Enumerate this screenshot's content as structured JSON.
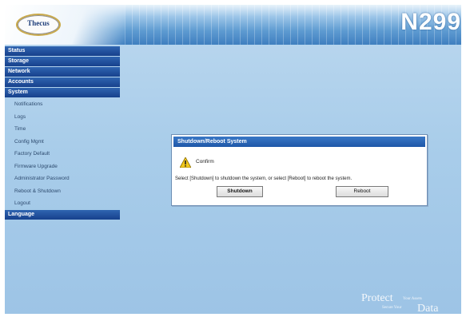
{
  "header": {
    "logo_text": "Thecus",
    "model": "N299"
  },
  "sidebar": {
    "sections": [
      {
        "label": "Status"
      },
      {
        "label": "Storage"
      },
      {
        "label": "Network"
      },
      {
        "label": "Accounts"
      },
      {
        "label": "System"
      }
    ],
    "system_items": [
      {
        "label": "Notifications"
      },
      {
        "label": "Logs"
      },
      {
        "label": "Time"
      },
      {
        "label": "Config Mgmt"
      },
      {
        "label": "Factory Default"
      },
      {
        "label": "Firmware Upgrade"
      },
      {
        "label": "Administrator Password"
      },
      {
        "label": "Reboot & Shutdown"
      },
      {
        "label": "Logout"
      }
    ],
    "language_label": "Language"
  },
  "dialog": {
    "title": "Shutdown/Reboot System",
    "confirm_label": "Confirm",
    "message": "Select [Shutdown] to shutdown the system, or select [Reboot] to reboot the system.",
    "shutdown_label": "Shutdown",
    "reboot_label": "Reboot"
  },
  "tagline": {
    "protect": "Protect",
    "your_assets": "Your Assets",
    "secure_your": "Secure Your",
    "data": "Data"
  },
  "colors": {
    "nav_bar": "#17418c",
    "dialog_title": "#1e57a8",
    "background": "#a9cdea"
  }
}
